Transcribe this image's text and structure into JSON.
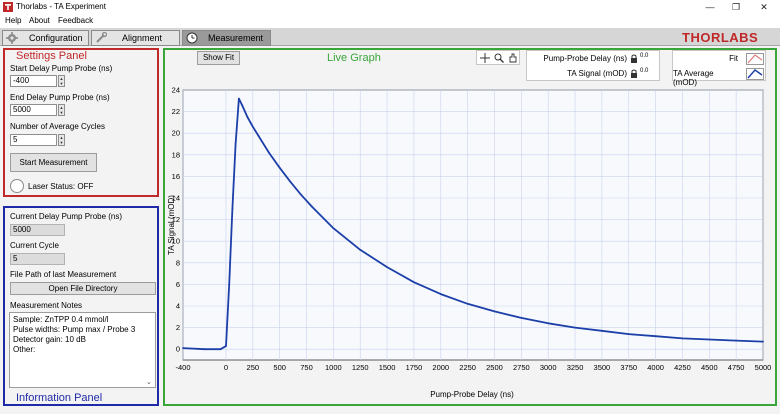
{
  "window": {
    "title": "Thorlabs - TA Experiment",
    "minimize": "—",
    "maximize": "❐",
    "close": "✕"
  },
  "menu": [
    "Help",
    "About",
    "Feedback"
  ],
  "tabs": [
    {
      "label": "Configuration",
      "active": false
    },
    {
      "label": "Alignment",
      "active": false
    },
    {
      "label": "Measurement",
      "active": true
    }
  ],
  "settings": {
    "title": "Settings Panel",
    "start_delay_label": "Start Delay Pump Probe (ns)",
    "start_delay_value": "-400",
    "end_delay_label": "End Delay Pump Probe (ns)",
    "end_delay_value": "5000",
    "avg_cycles_label": "Number of Average Cycles",
    "avg_cycles_value": "5",
    "start_button": "Start Measurement",
    "laser_status": "Laser Status: OFF"
  },
  "info": {
    "title": "Information Panel",
    "current_delay_label": "Current Delay Pump Probe (ns)",
    "current_delay_value": "5000",
    "current_cycle_label": "Current Cycle",
    "current_cycle_value": "5",
    "file_path_label": "File Path of last Measurement",
    "open_dir_button": "Open File Directory",
    "notes_label": "Measurement Notes",
    "notes_lines": [
      "Sample: ZnTPP 0.4 mmol/l",
      "Pulse widths: Pump max / Probe 3",
      "Detector gain: 10 dB",
      "Other:"
    ]
  },
  "graph": {
    "title": "Live Graph",
    "show_fit_button": "Show Fit",
    "scale_legend": [
      {
        "name": "Pump-Probe Delay (ns)",
        "format": "0.0"
      },
      {
        "name": "TA Signal (mOD)",
        "format": "0.0"
      }
    ],
    "plot_legend": [
      {
        "name": "Fit",
        "color": "#e07a7a"
      },
      {
        "name": "TA Average (mOD)",
        "color": "#1c3fa8"
      }
    ],
    "brand": "THORLABS",
    "brand_color": "#c0292a"
  },
  "chart_data": {
    "type": "line",
    "xlabel": "Pump-Probe Delay (ns)",
    "ylabel": "TA Signal (mOD)",
    "xlim": [
      -400,
      5000
    ],
    "ylim": [
      -1,
      24
    ],
    "xticks": [
      -400,
      0,
      250,
      500,
      750,
      1000,
      1250,
      1500,
      1750,
      2000,
      2250,
      2500,
      2750,
      3000,
      3250,
      3500,
      3750,
      4000,
      4250,
      4500,
      4750,
      5000
    ],
    "yticks": [
      0,
      2,
      4,
      6,
      8,
      10,
      12,
      14,
      16,
      18,
      20,
      22,
      24
    ],
    "grid": true,
    "series": [
      {
        "name": "TA Average (mOD)",
        "color": "#1c3fa8",
        "x": [
          -400,
          -200,
          -50,
          0,
          30,
          60,
          90,
          120,
          150,
          200,
          250,
          300,
          400,
          500,
          600,
          700,
          800,
          1000,
          1250,
          1500,
          1750,
          2000,
          2250,
          2500,
          2750,
          3000,
          3250,
          3500,
          3750,
          4000,
          4250,
          4500,
          4750,
          5000
        ],
        "y": [
          0.1,
          0.0,
          0.0,
          0.3,
          6.0,
          13.0,
          19.0,
          23.2,
          22.6,
          21.5,
          20.6,
          19.8,
          18.2,
          16.8,
          15.5,
          14.3,
          13.2,
          11.2,
          9.2,
          7.6,
          6.2,
          5.1,
          4.2,
          3.5,
          2.9,
          2.4,
          2.0,
          1.7,
          1.4,
          1.2,
          1.0,
          0.9,
          0.8,
          0.7
        ]
      }
    ]
  }
}
